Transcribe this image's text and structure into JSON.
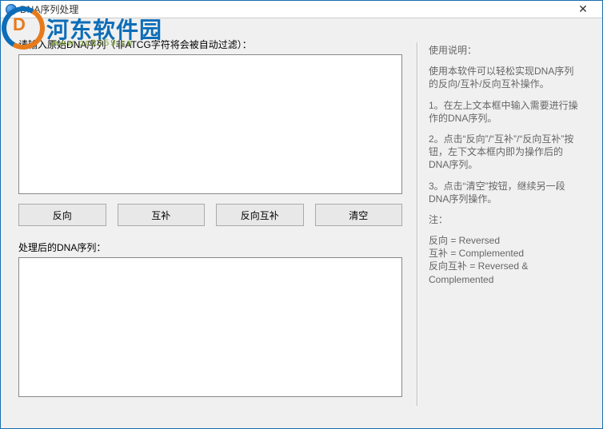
{
  "window": {
    "title": "DNA序列处理",
    "close": "✕"
  },
  "input_label": "请输入原始DNA序列（非ATCG字符将会被自动过滤）：",
  "output_label": "处理后的DNA序列：",
  "input_value": "",
  "output_value": "",
  "buttons": {
    "reverse": "反向",
    "complement": "互补",
    "reverse_complement": "反向互补",
    "clear": "清空"
  },
  "instructions": {
    "title": "使用说明：",
    "p1": "使用本软件可以轻松实现DNA序列的反向/互补/反向互补操作。",
    "p2": "1。在左上文本框中输入需要进行操作的DNA序列。",
    "p3": "2。点击“反向”/“互补”/“反向互补”按钮，左下文本框内即为操作后的DNA序列。",
    "p4": "3。点击“清空”按钮，继续另一段DNA序列操作。",
    "note_label": "注：",
    "note1": "反向 = Reversed",
    "note2": "互补 = Complemented",
    "note3": "反向互补 = Reversed & Complemented"
  },
  "watermark": {
    "inner": "D",
    "main": "河东软件园",
    "sub": "www.pc0359.cn"
  }
}
